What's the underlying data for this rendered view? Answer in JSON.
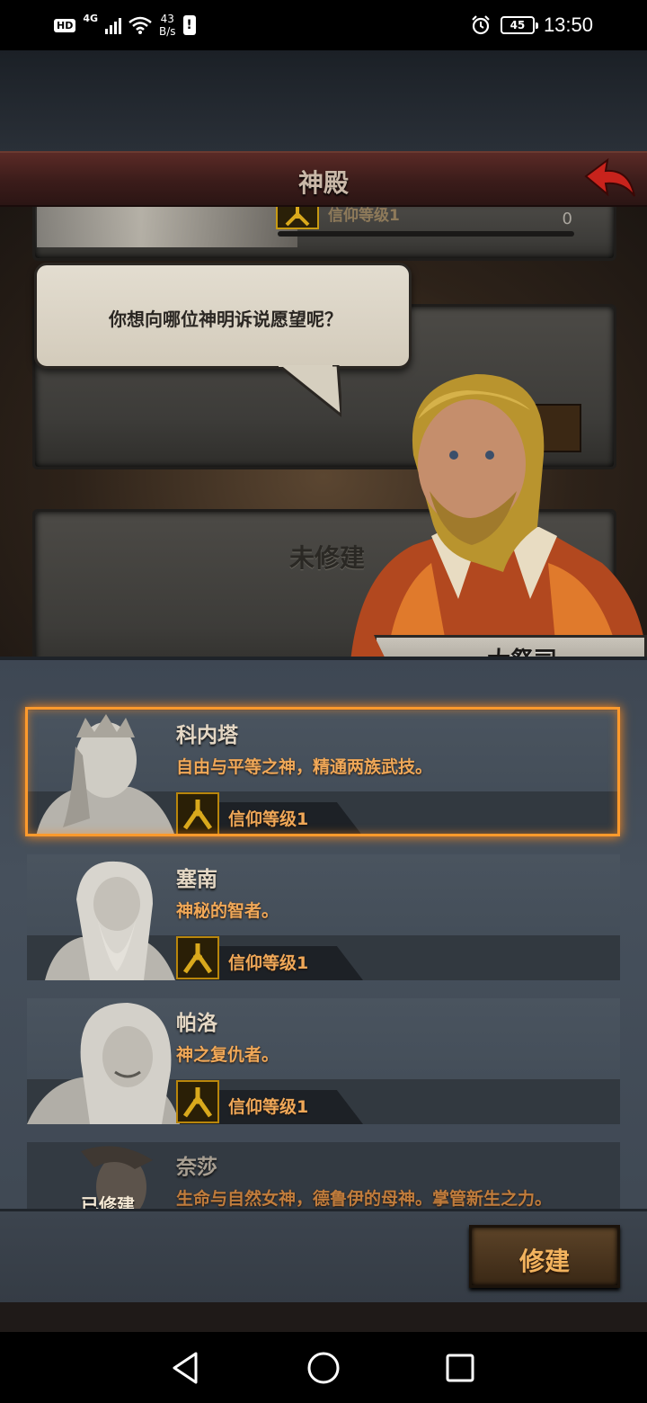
{
  "status_bar": {
    "hd": "HD",
    "network": "4G",
    "speed_value": "43",
    "speed_unit": "B/s",
    "warning": "!",
    "battery": "45",
    "time": "13:50"
  },
  "header": {
    "title": "神殿"
  },
  "background": {
    "top_panel_faith": "信仰等级1",
    "top_panel_progress": "0",
    "unbuilt_label": "未修建"
  },
  "dialog": {
    "text": "你想向哪位神明诉说愿望呢？",
    "speaker": "大祭司"
  },
  "gods": [
    {
      "name": "科内塔",
      "desc": "自由与平等之神，精通两族武技。",
      "faith": "信仰等级1",
      "selected": true,
      "built": ""
    },
    {
      "name": "塞南",
      "desc": "神秘的智者。",
      "faith": "信仰等级1",
      "selected": false,
      "built": ""
    },
    {
      "name": "帕洛",
      "desc": "神之复仇者。",
      "faith": "信仰等级1",
      "selected": false,
      "built": ""
    },
    {
      "name": "奈莎",
      "desc": "生命与自然女神，德鲁伊的母神。掌管新生之力。",
      "faith": "",
      "selected": false,
      "built": "已修建"
    }
  ],
  "actions": {
    "build": "修建"
  },
  "colors": {
    "highlight": "#ff9a2c",
    "desc_text": "#f0a858",
    "header_bg": "#4a2220",
    "badge_gold": "#c89a12"
  },
  "icons": {
    "back": "back-arrow-icon",
    "faith": "faith-emblem-icon",
    "nav": [
      "back-triangle-icon",
      "home-circle-icon",
      "recents-square-icon"
    ]
  }
}
